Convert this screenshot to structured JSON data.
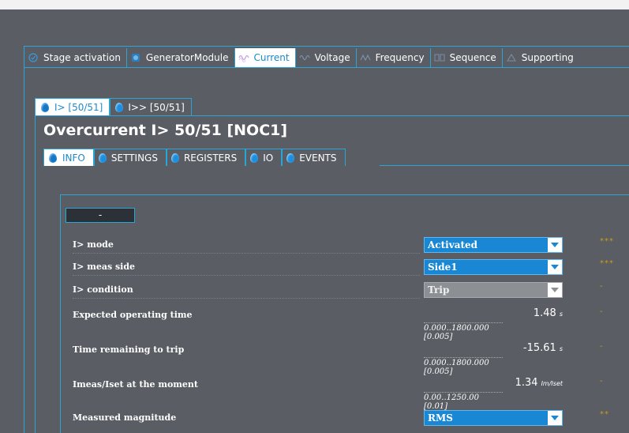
{
  "main_tabs": [
    {
      "label": "Stage activation",
      "icon": "check-circle-icon"
    },
    {
      "label": "GeneratorModule",
      "icon": "generator-icon"
    },
    {
      "label": "Current",
      "icon": "current-icon"
    },
    {
      "label": "Voltage",
      "icon": "voltage-icon"
    },
    {
      "label": "Frequency",
      "icon": "frequency-icon"
    },
    {
      "label": "Sequence",
      "icon": "sequence-icon"
    },
    {
      "label": "Supporting",
      "icon": "supporting-icon"
    }
  ],
  "stage_tabs": [
    {
      "label": "I> [50/51]"
    },
    {
      "label": "I>> [50/51]"
    }
  ],
  "title": "Overcurrent I> 50/51 [NOC1]",
  "section_tabs": [
    {
      "label": "INFO"
    },
    {
      "label": "SETTINGS"
    },
    {
      "label": "REGISTERS"
    },
    {
      "label": "IO"
    },
    {
      "label": "EVENTS"
    }
  ],
  "collapse_label": "-",
  "rows": {
    "mode": {
      "label": "I> mode",
      "value": "Activated",
      "stars": "***"
    },
    "meas_side": {
      "label": "I> meas side",
      "value": "Side1",
      "stars": "***"
    },
    "condition": {
      "label": "I> condition",
      "value": "Trip",
      "stars": "-"
    },
    "expected_time": {
      "label": "Expected operating time",
      "value": "1.48",
      "unit": "s",
      "range": "0.000..1800.000 [0.005]",
      "stars": "-"
    },
    "remaining_time": {
      "label": "Time remaining to trip",
      "value": "-15.61",
      "unit": "s",
      "range": "0.000..1800.000 [0.005]",
      "stars": "-"
    },
    "imeas": {
      "label": "Imeas/Iset at the moment",
      "value": "1.34",
      "unit": "Im/Iset",
      "range": "0.00..1250.00 [0.01]",
      "stars": "-"
    },
    "magnitude": {
      "label": "Measured magnitude",
      "value": "RMS",
      "stars": "**"
    }
  },
  "colors": {
    "accent": "#2aa6d6",
    "dropdown": "#1a87d4",
    "stars": "#c99a1a"
  }
}
